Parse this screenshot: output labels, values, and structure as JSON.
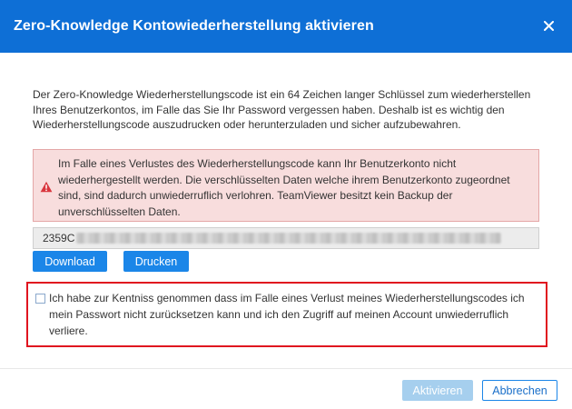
{
  "dialog": {
    "title": "Zero-Knowledge Kontowiederherstellung aktivieren",
    "close_icon": "close-icon",
    "description": "Der Zero-Knowledge Wiederherstellungscode ist ein 64 Zeichen langer Schlüssel zum wiederherstellen Ihres Benutzerkontos, im Falle das Sie Ihr Password vergessen haben. Deshalb ist es wichtig den Wiederherstellungscode auszudrucken oder herunterzuladen und sicher aufzubewahren.",
    "warning": {
      "icon": "warning-icon",
      "text": "Im Falle eines Verlustes des Wiederherstellungscode kann Ihr Benutzerkonto nicht wiederhergestellt werden. Die verschlüsselten Daten welche ihrem Benutzerkonto zugeordnet sind, sind dadurch unwiederruflich verlohren. TeamViewer besitzt kein Backup der unverschlüsselten Daten."
    },
    "recovery_code": {
      "visible_prefix": "2359C"
    },
    "buttons": {
      "download": "Download",
      "print": "Drucken",
      "activate": "Aktivieren",
      "cancel": "Abbrechen"
    },
    "confirmation": {
      "checked": false,
      "text": "Ich habe zur Kentniss genommen dass im Falle eines Verlust meines Wiederherstellungscodes ich mein Passwort nicht zurücksetzen kann und ich den Zugriff auf meinen Account unwiederruflich verliere."
    },
    "colors": {
      "header": "#0e6fd6",
      "warning_bg": "#f8dddd",
      "warning_icon": "#d9363e",
      "primary": "#1b86e8",
      "highlight_border": "#e0141f"
    }
  }
}
